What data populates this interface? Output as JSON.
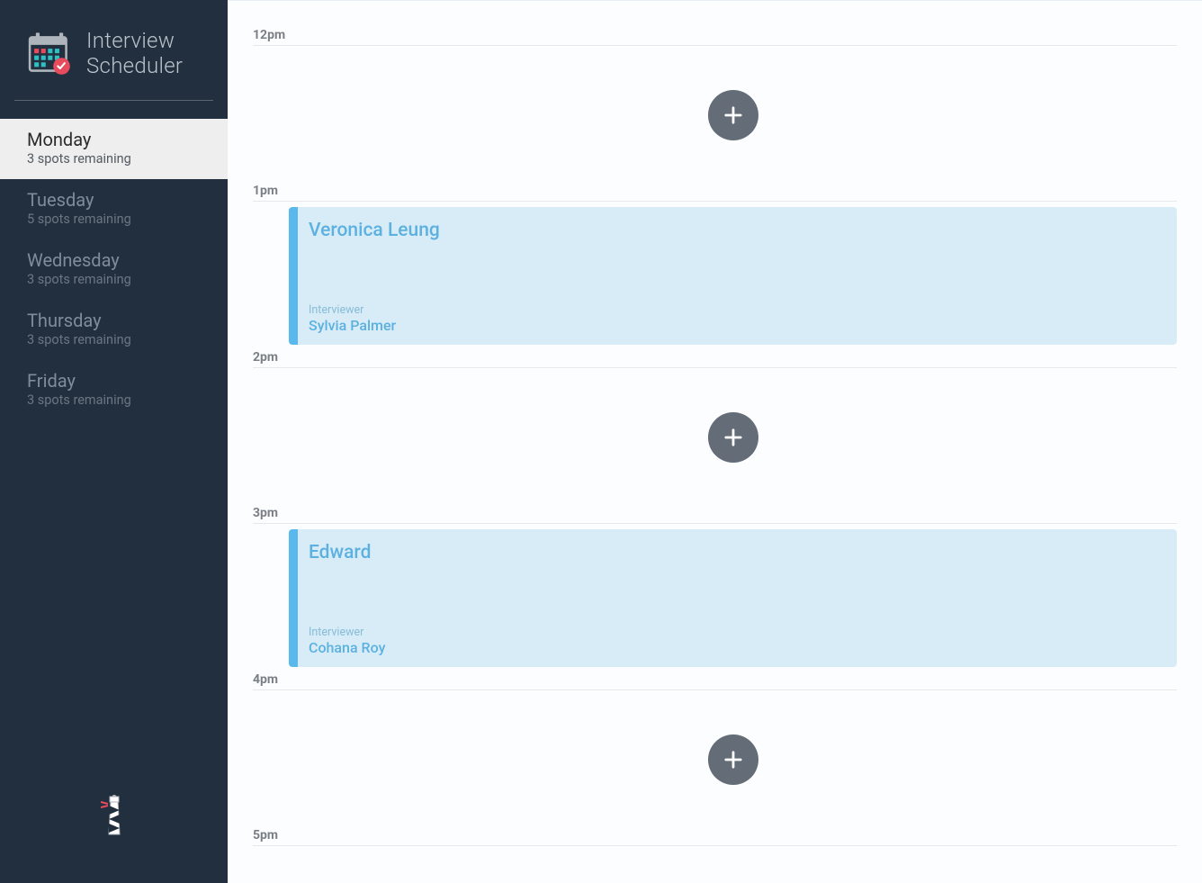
{
  "app": {
    "title_line1": "Interview",
    "title_line2": "Scheduler"
  },
  "sidebar": {
    "days": [
      {
        "name": "Monday",
        "spots": "3 spots remaining",
        "selected": true
      },
      {
        "name": "Tuesday",
        "spots": "5 spots remaining",
        "selected": false
      },
      {
        "name": "Wednesday",
        "spots": "3 spots remaining",
        "selected": false
      },
      {
        "name": "Thursday",
        "spots": "3 spots remaining",
        "selected": false
      },
      {
        "name": "Friday",
        "spots": "3 spots remaining",
        "selected": false
      }
    ]
  },
  "schedule": {
    "interviewer_label": "Interviewer",
    "slots": [
      {
        "time": "12pm",
        "type": "empty"
      },
      {
        "time": "1pm",
        "type": "booked",
        "student": "Veronica Leung",
        "interviewer": "Sylvia Palmer"
      },
      {
        "time": "2pm",
        "type": "empty"
      },
      {
        "time": "3pm",
        "type": "booked",
        "student": "Edward",
        "interviewer": "Cohana Roy"
      },
      {
        "time": "4pm",
        "type": "empty"
      },
      {
        "time": "5pm",
        "type": "end"
      }
    ]
  }
}
